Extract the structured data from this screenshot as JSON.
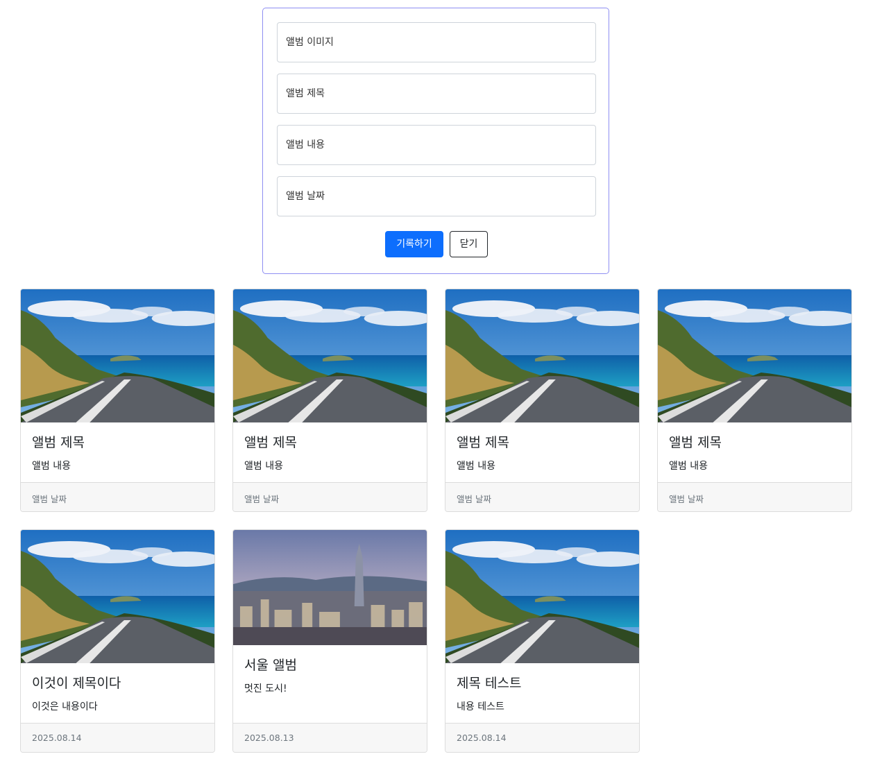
{
  "form": {
    "image_placeholder": "앨범 이미지",
    "title_placeholder": "앨범 제목",
    "content_placeholder": "앨범 내용",
    "date_placeholder": "앨범 날짜",
    "submit_label": "기록하기",
    "close_label": "닫기"
  },
  "cards": [
    {
      "title": "앨범 제목",
      "text": "앨범 내용",
      "date": "앨범 날짜",
      "image": "coastal-road-photo"
    },
    {
      "title": "앨범 제목",
      "text": "앨범 내용",
      "date": "앨범 날짜",
      "image": "coastal-road-photo"
    },
    {
      "title": "앨범 제목",
      "text": "앨범 내용",
      "date": "앨범 날짜",
      "image": "coastal-road-photo"
    },
    {
      "title": "앨범 제목",
      "text": "앨범 내용",
      "date": "앨범 날짜",
      "image": "coastal-road-photo"
    },
    {
      "title": "이것이 제목이다",
      "text": "이것은 내용이다",
      "date": "2025.08.14",
      "image": "coastal-road-photo"
    },
    {
      "title": "서울 앨범",
      "text": "멋진 도시!",
      "date": "2025.08.13",
      "image": "seoul-city-photo"
    },
    {
      "title": "제목 테스트",
      "text": "내용 테스트",
      "date": "2025.08.14",
      "image": "coastal-road-photo"
    }
  ]
}
